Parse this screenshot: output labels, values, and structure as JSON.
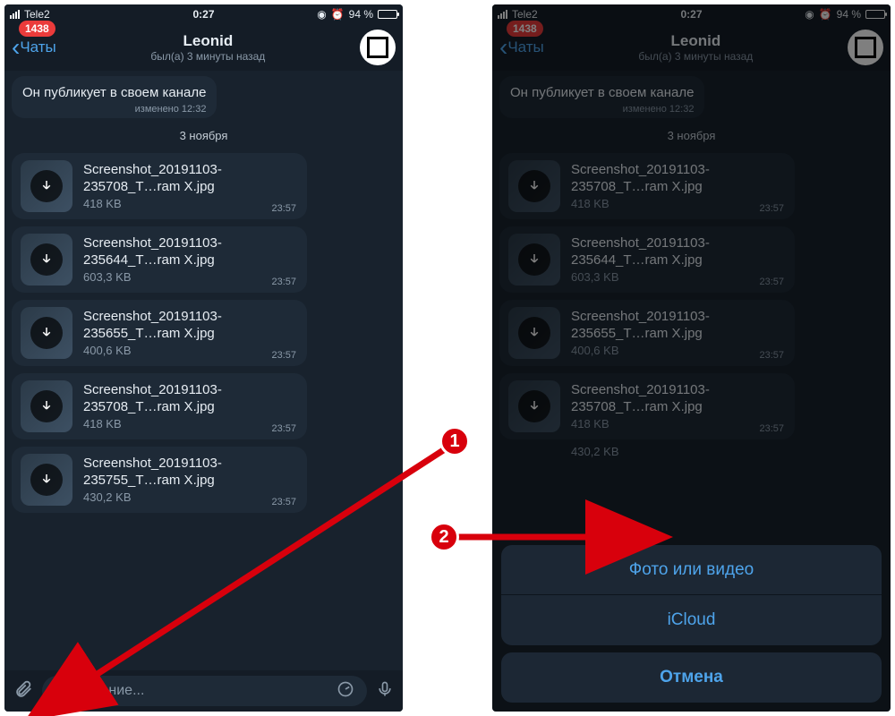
{
  "status": {
    "carrier": "Tele2",
    "time": "0:27",
    "battery_pct": "94 %",
    "alarm_glyph": "⏰",
    "loc_glyph": "➤"
  },
  "nav": {
    "back_label": "Чаты",
    "badge": "1438",
    "title": "Leonid",
    "subtitle": "был(а) 3 минуты назад"
  },
  "chat": {
    "text_msg": "Он публикует в своем канале",
    "edited": "изменено 12:32",
    "date": "3 ноября"
  },
  "files": [
    {
      "name_l1": "Screenshot_20191103-",
      "name_l2": "235708_T…ram X.jpg",
      "size": "418 KB",
      "time": "23:57"
    },
    {
      "name_l1": "Screenshot_20191103-",
      "name_l2": "235644_T…ram X.jpg",
      "size": "603,3 KB",
      "time": "23:57"
    },
    {
      "name_l1": "Screenshot_20191103-",
      "name_l2": "235655_T…ram X.jpg",
      "size": "400,6 KB",
      "time": "23:57"
    },
    {
      "name_l1": "Screenshot_20191103-",
      "name_l2": "235708_T…ram X.jpg",
      "size": "418 KB",
      "time": "23:57"
    },
    {
      "name_l1": "Screenshot_20191103-",
      "name_l2": "235755_T…ram X.jpg",
      "size": "430,2 KB",
      "time": "23:57"
    }
  ],
  "files_right_extra_size": "430,2 KB",
  "input": {
    "placeholder": "Сообщение..."
  },
  "sheet": {
    "opt1": "Фото или видео",
    "opt2": "iCloud",
    "cancel": "Отмена"
  },
  "callouts": {
    "one": "1",
    "two": "2"
  }
}
